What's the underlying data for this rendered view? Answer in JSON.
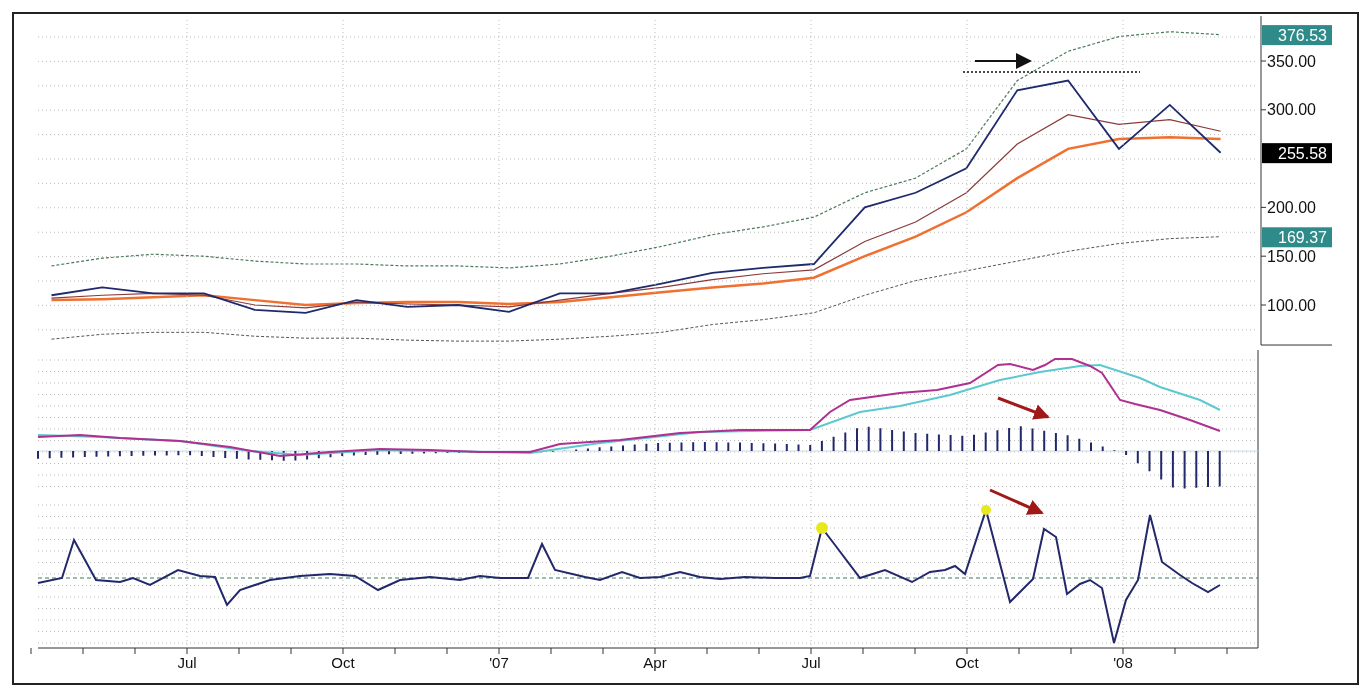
{
  "price_chart": {
    "chart_data": {
      "type": "line",
      "grid": true,
      "ylim": [
        59,
        396
      ],
      "series": [
        {
          "color": "#4a7a5a",
          "line_style": "dashed",
          "values": [
            140,
            148,
            152,
            150,
            145,
            142,
            142,
            140,
            140,
            138,
            142,
            150,
            160,
            172,
            180,
            190,
            215,
            230,
            260,
            330,
            360,
            375,
            380,
            377
          ]
        },
        {
          "color": "#555555",
          "line_style": "dashed",
          "values": [
            65,
            70,
            72,
            72,
            68,
            66,
            66,
            64,
            63,
            63,
            65,
            68,
            72,
            80,
            85,
            92,
            110,
            125,
            135,
            145,
            155,
            163,
            168,
            170
          ]
        },
        {
          "color": "#f07030",
          "values": [
            105,
            106,
            108,
            110,
            105,
            100,
            102,
            103,
            103,
            101,
            103,
            108,
            113,
            118,
            122,
            128,
            150,
            170,
            195,
            230,
            260,
            270,
            272,
            270
          ]
        },
        {
          "color": "#8b3a3a",
          "values": [
            107,
            110,
            112,
            110,
            100,
            97,
            103,
            101,
            100,
            98,
            105,
            112,
            118,
            126,
            132,
            136,
            165,
            185,
            215,
            265,
            295,
            285,
            290,
            278
          ]
        },
        {
          "color": "#1f2a6e",
          "values": [
            110,
            118,
            112,
            112,
            95,
            92,
            105,
            98,
            100,
            93,
            112,
            112,
            122,
            133,
            138,
            142,
            200,
            215,
            240,
            320,
            330,
            260,
            305,
            256
          ]
        }
      ],
      "yticks": [
        {
          "value": 100,
          "label": "100.00"
        },
        {
          "value": 150,
          "label": "150.00"
        },
        {
          "value": 200,
          "label": "200.00"
        },
        {
          "value": 300,
          "label": "300.00"
        },
        {
          "value": 350,
          "label": "350.00"
        }
      ]
    }
  },
  "time_axis": [
    {
      "label": "Jul"
    },
    {
      "label": "Oct"
    },
    {
      "label": "'07"
    },
    {
      "label": "Apr"
    },
    {
      "label": "Jul"
    },
    {
      "label": "Oct"
    },
    {
      "label": "'08"
    }
  ],
  "axis_badges": [
    {
      "text": "376.53",
      "kind": "band"
    },
    {
      "text": "255.58",
      "kind": "last"
    },
    {
      "text": "169.37",
      "kind": "band"
    }
  ]
}
